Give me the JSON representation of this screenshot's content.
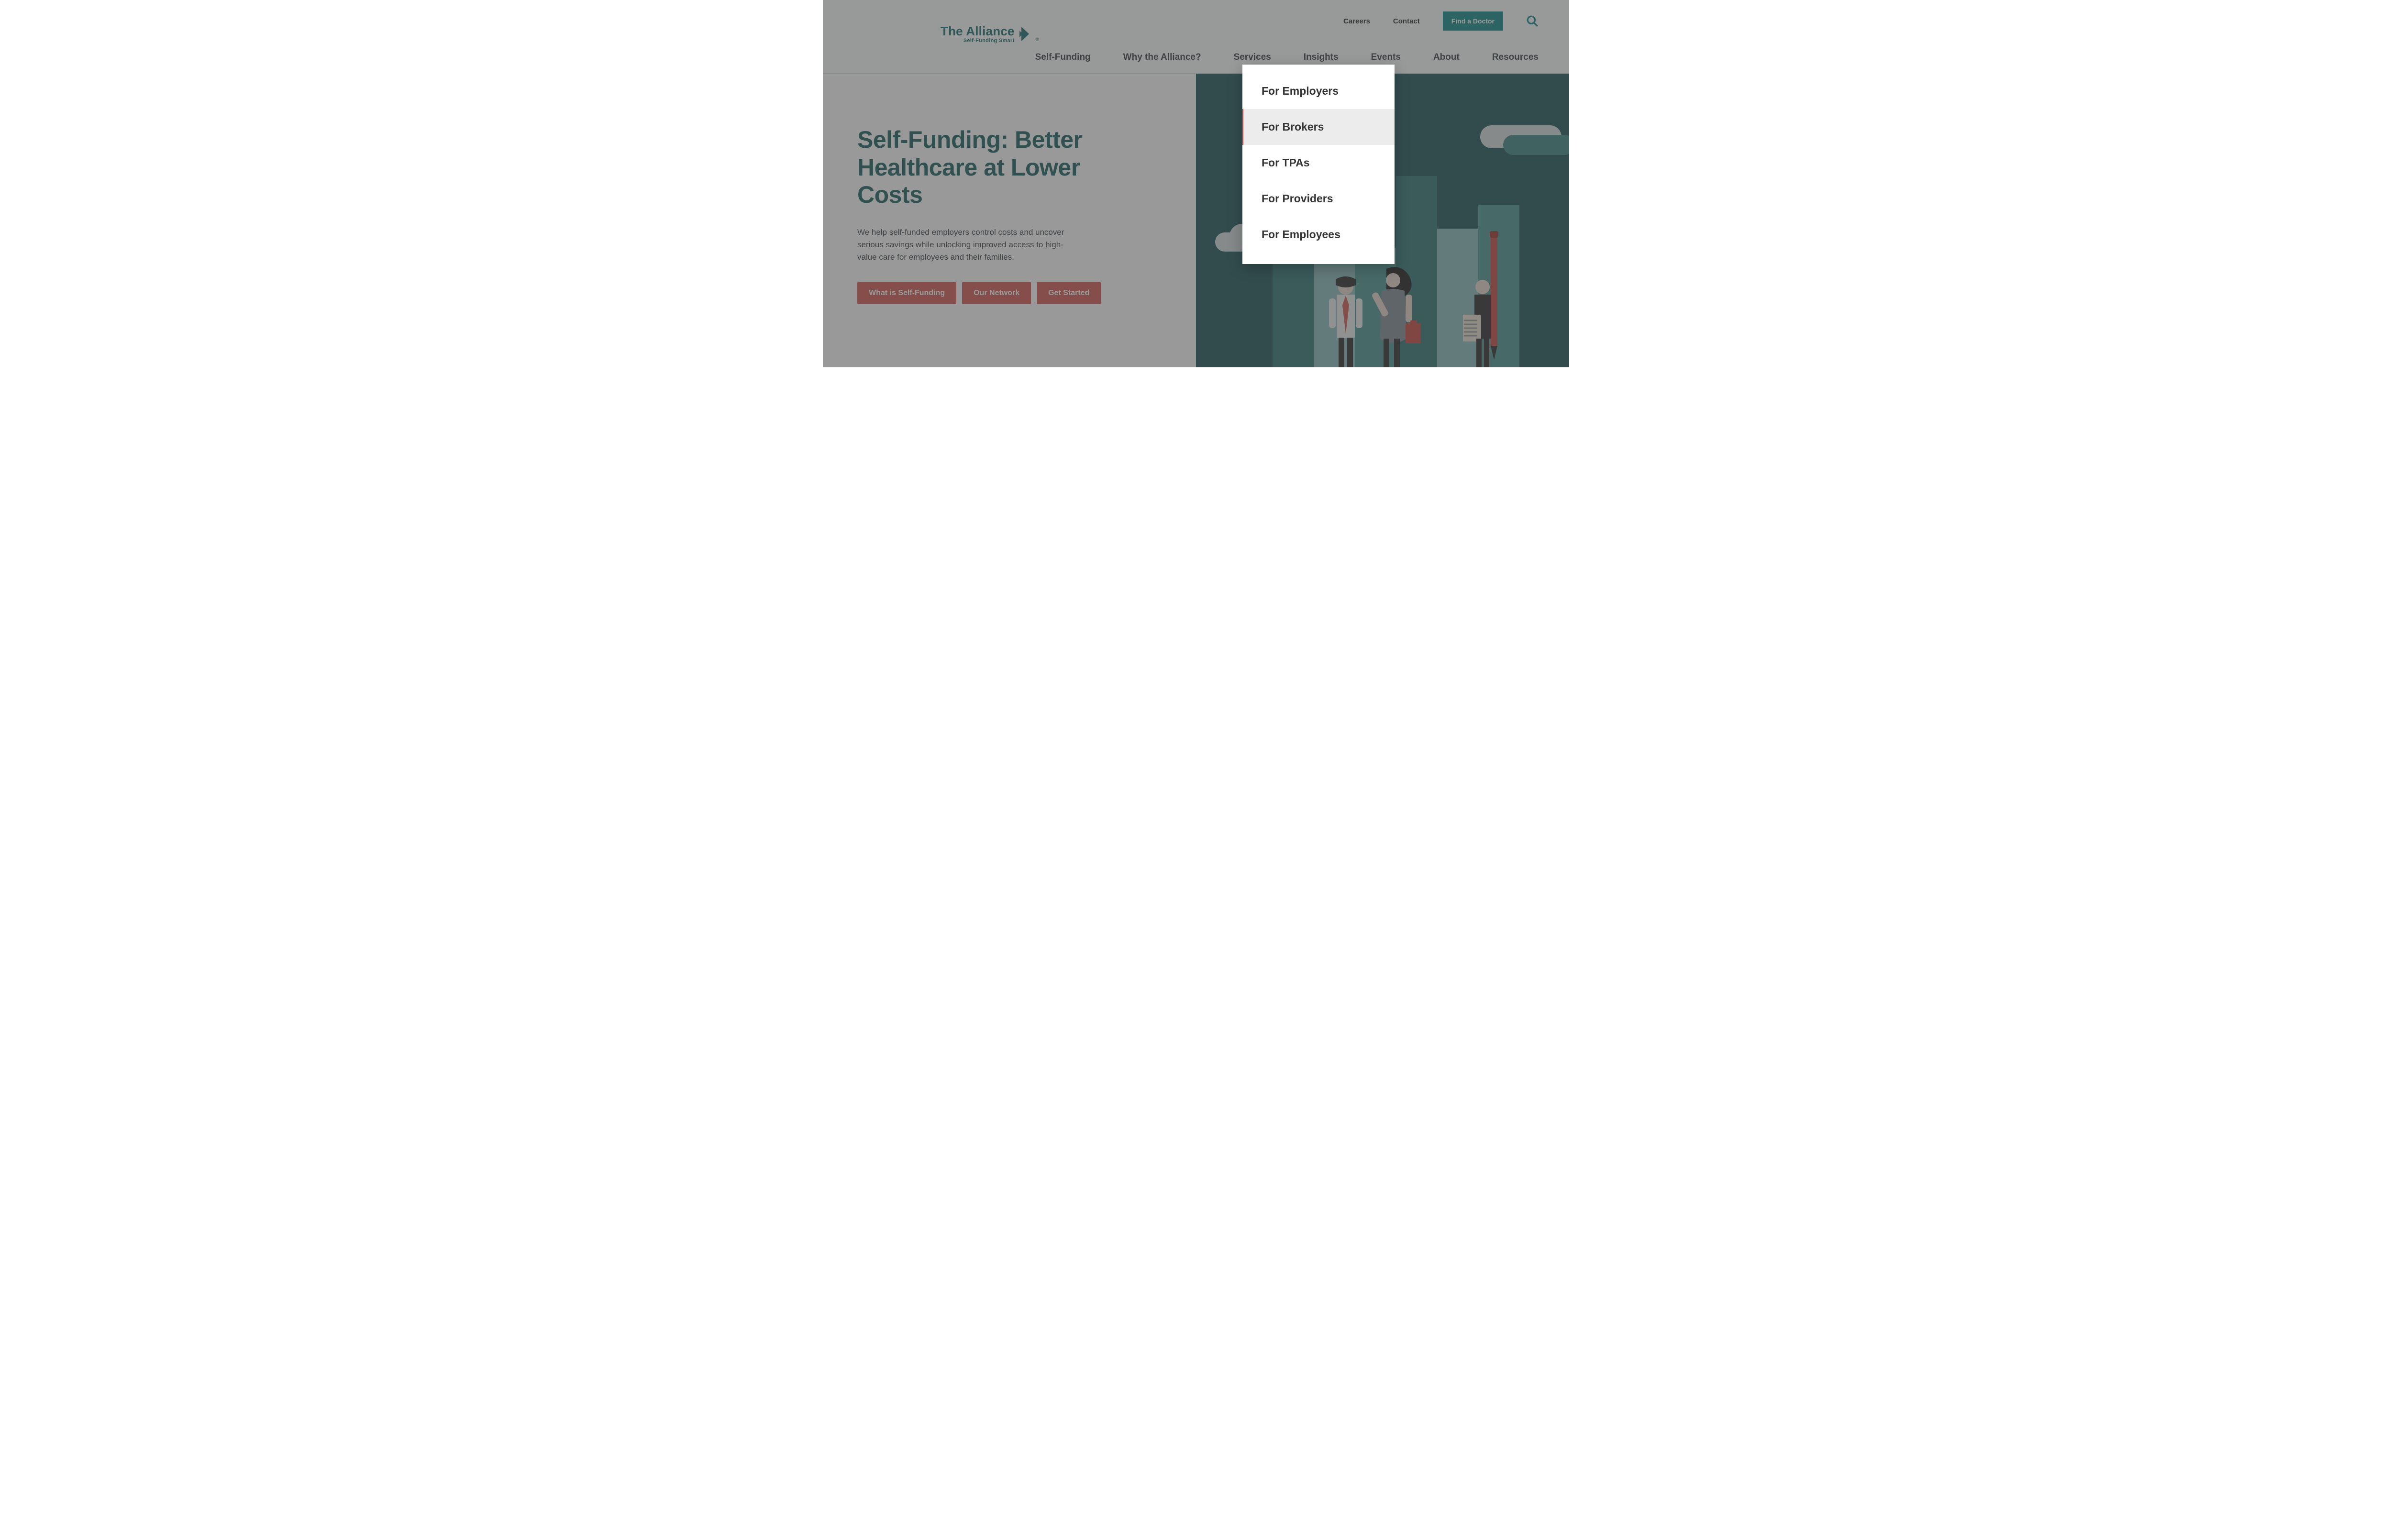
{
  "topbar": {
    "careers": "Careers",
    "contact": "Contact",
    "find_doctor": "Find a Doctor"
  },
  "logo": {
    "brand": "The Alliance",
    "tag": "Self-Funding Smart",
    "reg": "®"
  },
  "nav": {
    "self_funding": "Self-Funding",
    "why": "Why the Alliance?",
    "services": "Services",
    "insights": "Insights",
    "events": "Events",
    "about": "About",
    "resources": "Resources"
  },
  "dropdown": {
    "items": [
      {
        "label": "For Employers"
      },
      {
        "label": "For Brokers"
      },
      {
        "label": "For TPAs"
      },
      {
        "label": "For Providers"
      },
      {
        "label": "For Employees"
      }
    ],
    "hover_index": 1
  },
  "hero": {
    "title": "Self-Funding: Better Healthcare at Lower Costs",
    "blurb": "We help self-funded employers control costs and uncover serious savings while unlocking improved access to high-value care for employees and their families.",
    "btn1": "What is Self-Funding",
    "btn2": "Our Network",
    "btn3": "Get Started"
  }
}
